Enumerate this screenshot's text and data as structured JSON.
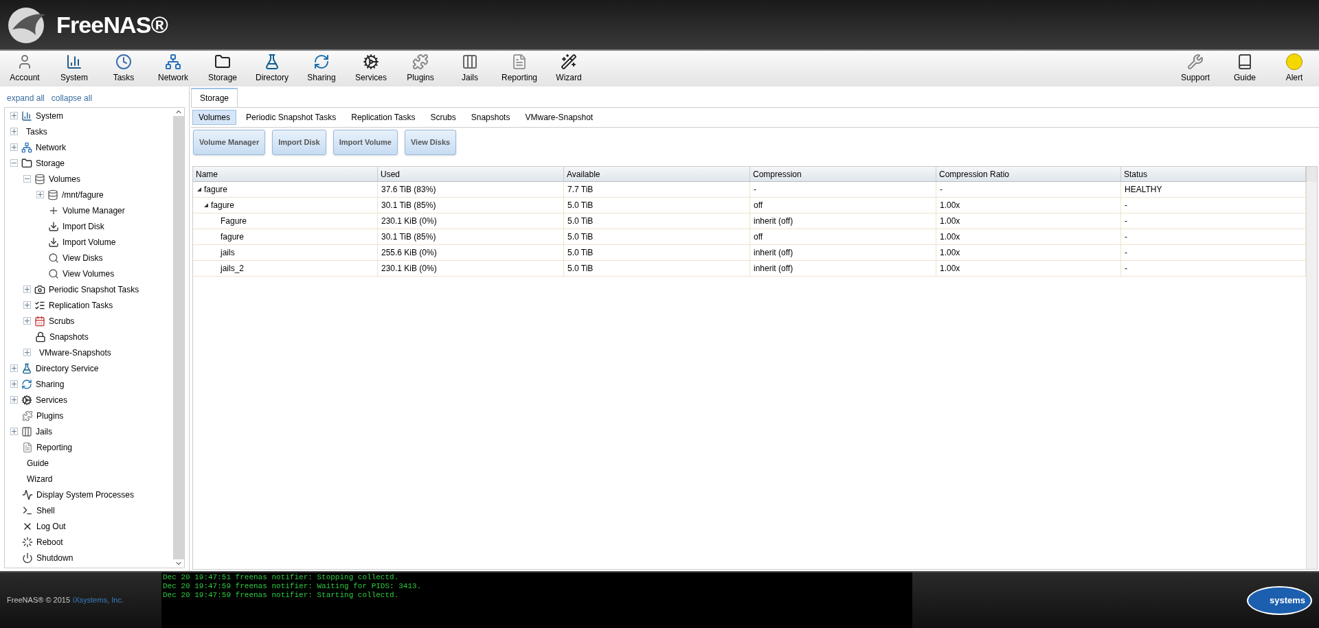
{
  "header": {
    "logo": "FreeNAS®"
  },
  "toolbar": {
    "left": [
      {
        "label": "Account",
        "kind": "account"
      },
      {
        "label": "System",
        "kind": "system"
      },
      {
        "label": "Tasks",
        "kind": "tasks"
      },
      {
        "label": "Network",
        "kind": "network"
      },
      {
        "label": "Storage",
        "kind": "storage"
      },
      {
        "label": "Directory",
        "kind": "directory"
      },
      {
        "label": "Sharing",
        "kind": "sharing"
      },
      {
        "label": "Services",
        "kind": "services"
      },
      {
        "label": "Plugins",
        "kind": "plugins"
      },
      {
        "label": "Jails",
        "kind": "jails"
      },
      {
        "label": "Reporting",
        "kind": "reporting"
      },
      {
        "label": "Wizard",
        "kind": "wizard"
      }
    ],
    "right": [
      {
        "label": "Support",
        "kind": "support"
      },
      {
        "label": "Guide",
        "kind": "guide"
      },
      {
        "label": "Alert",
        "kind": "alert"
      }
    ]
  },
  "sidebar": {
    "links": [
      "expand all",
      "collapse all"
    ],
    "items": [
      {
        "label": "System",
        "kind": "system",
        "expanded": false
      },
      {
        "label": "Tasks",
        "kind": "none",
        "expanded": false
      },
      {
        "label": "Network",
        "kind": "network",
        "expanded": false
      },
      {
        "label": "Storage",
        "kind": "storage",
        "expanded": true,
        "children": [
          {
            "label": "Volumes",
            "kind": "volume",
            "expanded": true,
            "children": [
              {
                "label": "/mnt/fagure",
                "kind": "volume",
                "expanded": false
              },
              {
                "label": "Volume Manager",
                "kind": "volume-add"
              },
              {
                "label": "Import Disk",
                "kind": "volume-import"
              },
              {
                "label": "Import Volume",
                "kind": "volume-import"
              },
              {
                "label": "View Disks",
                "kind": "volume-view"
              },
              {
                "label": "View Volumes",
                "kind": "volume-view"
              }
            ]
          },
          {
            "label": "Periodic Snapshot Tasks",
            "kind": "snapshot-clock",
            "expanded": false
          },
          {
            "label": "Replication Tasks",
            "kind": "replication",
            "expanded": false
          },
          {
            "label": "Scrubs",
            "kind": "calendar",
            "expanded": false
          },
          {
            "label": "Snapshots",
            "kind": "snapshot"
          },
          {
            "label": "VMware-Snapshots",
            "kind": "none",
            "expanded": false
          }
        ]
      },
      {
        "label": "Directory Service",
        "kind": "directory",
        "expanded": false
      },
      {
        "label": "Sharing",
        "kind": "sharing",
        "expanded": false
      },
      {
        "label": "Services",
        "kind": "services",
        "expanded": false
      },
      {
        "label": "Plugins",
        "kind": "plugins"
      },
      {
        "label": "Jails",
        "kind": "jails",
        "expanded": false
      },
      {
        "label": "Reporting",
        "kind": "reporting"
      },
      {
        "label": "Guide",
        "kind": "none"
      },
      {
        "label": "Wizard",
        "kind": "none"
      },
      {
        "label": "Display System Processes",
        "kind": "monitor"
      },
      {
        "label": "Shell",
        "kind": "shell"
      },
      {
        "label": "Log Out",
        "kind": "logout"
      },
      {
        "label": "Reboot",
        "kind": "reboot"
      },
      {
        "label": "Shutdown",
        "kind": "shutdown"
      }
    ]
  },
  "main_tabs": [
    {
      "label": "Storage",
      "selected": true
    }
  ],
  "sub_tabs": [
    {
      "label": "Volumes",
      "selected": true
    },
    {
      "label": "Periodic Snapshot Tasks",
      "selected": false
    },
    {
      "label": "Replication Tasks",
      "selected": false
    },
    {
      "label": "Scrubs",
      "selected": false
    },
    {
      "label": "Snapshots",
      "selected": false
    },
    {
      "label": "VMware-Snapshot",
      "selected": false
    }
  ],
  "buttons": [
    "Volume Manager",
    "Import Disk",
    "Import Volume",
    "View Disks"
  ],
  "table": {
    "columns": [
      "Name",
      "Used",
      "Available",
      "Compression",
      "Compression Ratio",
      "Status"
    ],
    "rows": [
      {
        "cells": [
          "fagure",
          "37.6 TiB (83%)",
          "7.7 TiB",
          "-",
          "-",
          "HEALTHY"
        ],
        "expanded": true,
        "children": [
          {
            "cells": [
              "fagure",
              "30.1 TiB (85%)",
              "5.0 TiB",
              "off",
              "1.00x",
              "-"
            ],
            "expanded": true,
            "children": [
              {
                "cells": [
                  "Fagure",
                  "230.1 KiB (0%)",
                  "5.0 TiB",
                  "inherit (off)",
                  "1.00x",
                  "-"
                ]
              },
              {
                "cells": [
                  "fagure",
                  "30.1 TiB (85%)",
                  "5.0 TiB",
                  "off",
                  "1.00x",
                  "-"
                ]
              },
              {
                "cells": [
                  "jails",
                  "255.6 KiB (0%)",
                  "5.0 TiB",
                  "inherit (off)",
                  "1.00x",
                  "-"
                ]
              },
              {
                "cells": [
                  "jails_2",
                  "230.1 KiB (0%)",
                  "5.0 TiB",
                  "inherit (off)",
                  "1.00x",
                  "-"
                ]
              }
            ]
          }
        ]
      }
    ]
  },
  "footer": {
    "copyright": "FreeNAS® © 2015",
    "company_link": "iXsystems, Inc.",
    "log": [
      "Dec 20 19:47:51 freenas notifier: Stopping collectd.",
      "Dec 20 19:47:59 freenas notifier: Waiting for PIDS: 3413.",
      "Dec 20 19:47:59 freenas notifier: Starting collectd."
    ],
    "logo": "systems"
  }
}
